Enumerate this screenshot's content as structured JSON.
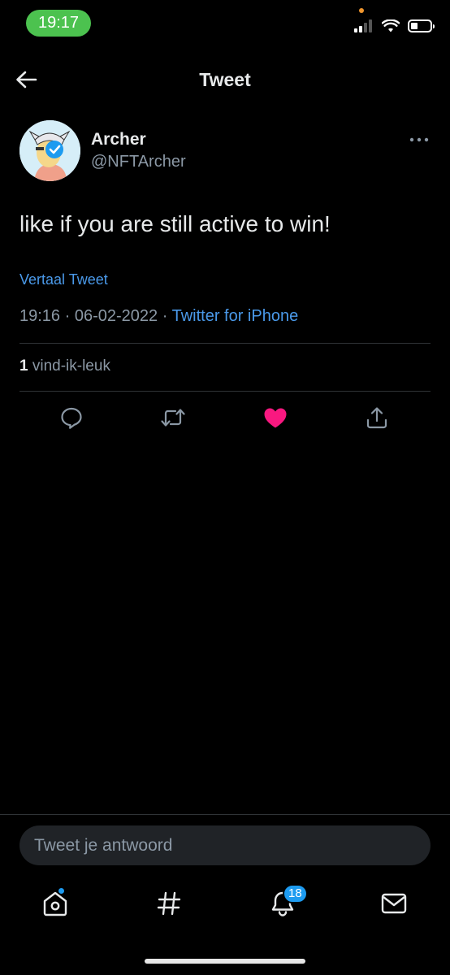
{
  "status_bar": {
    "time": "19:17"
  },
  "header": {
    "title": "Tweet"
  },
  "tweet": {
    "author_name": "Archer",
    "author_handle": "@NFTArcher",
    "text": "like if you are still active to win!",
    "translate_label": "Vertaal Tweet",
    "time": "19:16",
    "separator": " · ",
    "date": "06-02-2022",
    "source": "Twitter for iPhone",
    "likes_count": "1",
    "likes_label": "vind-ik-leuk",
    "liked": true
  },
  "reply": {
    "placeholder": "Tweet je antwoord"
  },
  "tab_bar": {
    "notifications_badge": "18"
  },
  "colors": {
    "background": "#000000",
    "accent": "#1d9bf0",
    "like": "#f91880",
    "secondary_text": "#8b98a5",
    "time_pill": "#4cc24f"
  },
  "icons": {
    "back": "arrow-left-icon",
    "more": "ellipsis-icon",
    "reply": "comment-icon",
    "retweet": "retweet-icon",
    "like": "heart-filled-icon",
    "share": "share-icon",
    "home": "home-icon",
    "explore": "hashtag-icon",
    "notifications": "bell-icon",
    "messages": "mail-icon"
  }
}
